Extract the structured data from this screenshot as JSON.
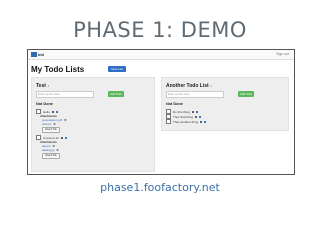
{
  "slide": {
    "title": "PHASE 1: DEMO",
    "footer_url": "phase1.foofactory.net"
  },
  "app": {
    "logo_text": "bbl",
    "signout": "Sign out",
    "main_title": "My Todo Lists",
    "new_list_label": "New List"
  },
  "lists": [
    {
      "title": "Test",
      "title_icon": "chevron-up-down-icon",
      "input_placeholder": "Enter up the todo",
      "add_label": "Add Todo",
      "section": "Not Done",
      "todos": [
        {
          "text": "Hello",
          "attachments_label": "Attachments",
          "attachments": [
            "presentation.pdf",
            "todo.txt"
          ],
          "attach_btn": "Attach File"
        },
        {
          "text": "A todo to do",
          "attachments_label": "Attachments",
          "attachments": [
            "aaa.txt",
            "aaaaa.jpg"
          ],
          "attach_btn": "Attach File"
        }
      ]
    },
    {
      "title": "Another Todo List",
      "title_icon": "chevron-up-down-icon",
      "input_placeholder": "Enter up the todo",
      "add_label": "Add Todo",
      "section": "Not Done",
      "todos": [
        {
          "text": "Do this thing"
        },
        {
          "text": "Then that thing"
        },
        {
          "text": "Then another thing"
        }
      ]
    }
  ],
  "colors": {
    "title_gray": "#5f6b74",
    "link_blue": "#3a6fa8",
    "primary_btn": "#2e6ec7",
    "success_btn": "#5cb85c",
    "panel_bg": "#eeeeee"
  }
}
